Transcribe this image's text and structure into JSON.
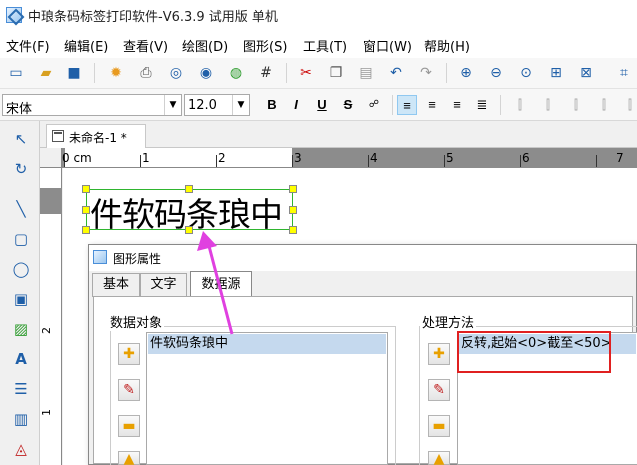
{
  "window": {
    "title": "中琅条码标签打印软件-V6.3.9 试用版 单机"
  },
  "menu": [
    {
      "label": "文件(F)"
    },
    {
      "label": "编辑(E)"
    },
    {
      "label": "查看(V)"
    },
    {
      "label": "绘图(D)"
    },
    {
      "label": "图形(S)"
    },
    {
      "label": "工具(T)"
    },
    {
      "label": "窗口(W)"
    },
    {
      "label": "帮助(H)"
    }
  ],
  "font_toolbar": {
    "font_name": "宋体",
    "font_size": "12.0",
    "bold": "B",
    "italic": "I",
    "underline": "U",
    "strike": "S"
  },
  "document": {
    "tab_label": "未命名-1 *"
  },
  "ruler": {
    "h_labels": [
      "0 cm",
      "1",
      "2",
      "3",
      "4",
      "5",
      "6",
      "7"
    ],
    "v_labels": [
      "1",
      "2"
    ]
  },
  "canvas": {
    "text_object": "件软码条琅中"
  },
  "dialog": {
    "title": "图形属性",
    "tabs": [
      {
        "label": "基本"
      },
      {
        "label": "文字"
      },
      {
        "label": "数据源"
      }
    ],
    "data_objects": {
      "label": "数据对象",
      "items": [
        "件软码条琅中"
      ]
    },
    "processing": {
      "label": "处理方法",
      "items": [
        "反转,起始<0>截至<50>"
      ]
    }
  },
  "colors": {
    "selection_border": "#2fb52f",
    "handle": "#ffff00",
    "highlight_box": "#e02020",
    "arrow": "#e040e0",
    "list_selection": "#c5d9ee"
  }
}
